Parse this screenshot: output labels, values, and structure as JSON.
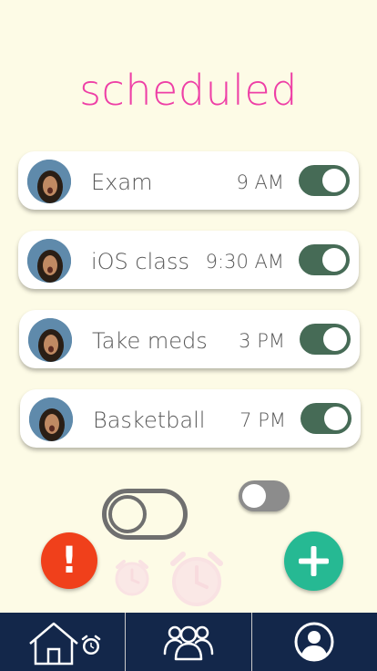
{
  "screen": {
    "title": "scheduled"
  },
  "alarms": [
    {
      "name": "Exam",
      "time": "9 AM",
      "enabled": true
    },
    {
      "name": "iOS class",
      "time": "9:30 AM",
      "enabled": true
    },
    {
      "name": "Take meds",
      "time": "3 PM",
      "enabled": true
    },
    {
      "name": "Basketball",
      "time": "7 PM",
      "enabled": true
    }
  ],
  "controls": {
    "alert_symbol": "!",
    "small_toggle_on": false,
    "big_toggle_on": false
  },
  "colors": {
    "background": "#fdfbe6",
    "title": "#ee3fa6",
    "switch_on": "#466b56",
    "alert": "#f0401b",
    "add": "#26b993",
    "tabbar": "#13274a"
  },
  "tabs": [
    {
      "icon": "home-alarm-icon"
    },
    {
      "icon": "group-icon"
    },
    {
      "icon": "profile-icon"
    }
  ]
}
